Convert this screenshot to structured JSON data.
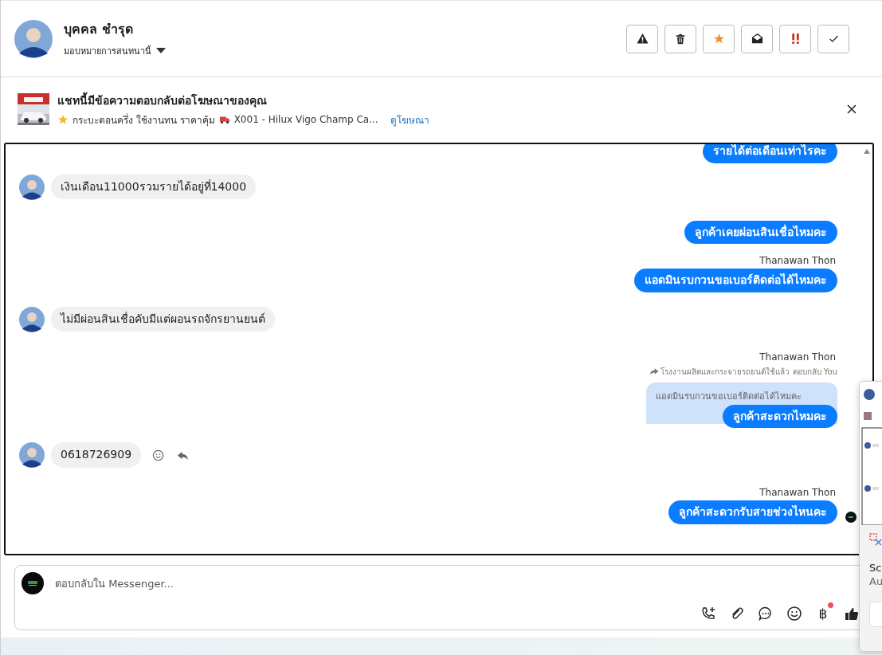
{
  "header": {
    "name": "บุคคล ชำรุด",
    "assign_label": "มอบหมายการสนทนานี้"
  },
  "ad_banner": {
    "title": "แชทนี้มีข้อความตอบกลับต่อโฆษณาของคุณ",
    "description": "กระบะตอนครึ่ง ใช้งานทน ราคาคุ้ม",
    "product": "X001 - Hilux Vigo Champ Ca...",
    "link": "ดูโฆษณา"
  },
  "messages": [
    {
      "kind": "out",
      "text": "รายได้ต่อเดือนเท่าไรคะ"
    },
    {
      "kind": "in",
      "text": "เงินเดือน11000รวมรายได้อยู่ที่14000",
      "show_actions": false
    },
    {
      "kind": "out",
      "text": "ลูกค้าเคยผ่อนสินเชื่อไหมคะ"
    },
    {
      "kind": "sender",
      "text": "Thanawan Thon"
    },
    {
      "kind": "out",
      "text": "แอดมินรบกวนขอเบอร์ติดต่อได้ไหมคะ"
    },
    {
      "kind": "in",
      "text": "ไม่มีผ่อนสินเชื่อคับมีแต่ผอนรถจักรยานยนต์",
      "show_actions": false
    },
    {
      "kind": "sender",
      "text": "Thanawan Thon"
    },
    {
      "kind": "reply_context",
      "text": "โรงงานผลิตและกระจายรถยนต์ใช้แล้ว ตอบกลับ You"
    },
    {
      "kind": "quote",
      "text": "แอดมินรบกวนขอเบอร์ติดต่อได้ไหมคะ"
    },
    {
      "kind": "out",
      "text": "ลูกค้าสะดวกไหมคะ",
      "seen": false
    },
    {
      "kind": "in",
      "text": "0618726909",
      "show_actions": true
    },
    {
      "kind": "sender",
      "text": "Thanawan Thon"
    },
    {
      "kind": "out",
      "text": "ลูกค้าสะดวกรับสายช่วงไหนคะ",
      "seen": true
    }
  ],
  "composer": {
    "placeholder": "ตอบกลับใน Messenger...",
    "currency_symbol": "฿"
  },
  "popup": {
    "line_1": "Sc",
    "line_2": "Au"
  }
}
